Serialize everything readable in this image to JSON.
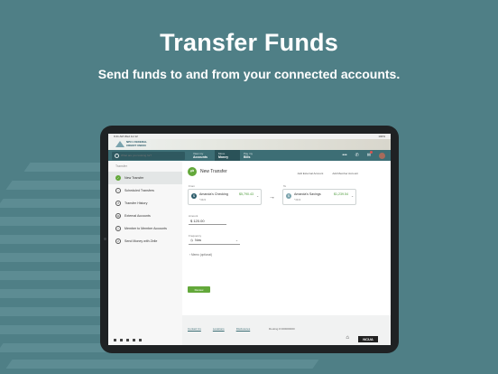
{
  "hero": {
    "title": "Transfer Funds",
    "subtitle": "Send funds to and from your connected accounts."
  },
  "statusbar": {
    "time": "9:41 AM   Wed Jul 12",
    "battery": "100%"
  },
  "brand": {
    "line1": "NPC1 FEDERAL",
    "line2": "CREDIT UNION"
  },
  "search": {
    "placeholder": "What are you looking for?"
  },
  "nav": {
    "tabs": [
      {
        "top": "View my",
        "bottom": "Accounts"
      },
      {
        "top": "Move",
        "bottom": "Money"
      },
      {
        "top": "Pay my",
        "bottom": "Bills"
      }
    ],
    "active_tab": 1
  },
  "sidebar": {
    "heading": "Transfer",
    "items": [
      {
        "label": "New Transfer",
        "active": true
      },
      {
        "label": "Scheduled Transfers"
      },
      {
        "label": "Transfer History"
      },
      {
        "label": "External Accounts"
      },
      {
        "label": "Member to Member Accounts"
      },
      {
        "label": "Send Money with Zelle"
      }
    ]
  },
  "transfer": {
    "title": "New Transfer",
    "add_external": "Add External Account",
    "add_member": "Add Member Account",
    "from_label": "From",
    "to_label": "To",
    "from": {
      "name": "Amanda's Checking",
      "sub": "*4321",
      "balance": "$5,790.43"
    },
    "to": {
      "name": "Amanda's Savings",
      "sub": "*4322",
      "balance": "$1,239.54"
    },
    "amount_label": "Amount",
    "amount": "$ 120.00",
    "frequency_label": "Frequency",
    "frequency": "Now",
    "memo": "Memo (optional)",
    "review_button": "Review"
  },
  "footer": {
    "links": [
      "Contact Us",
      "Locations",
      "Disclosures"
    ],
    "routing": "Routing # 000000000",
    "ncua": "NCUA"
  },
  "colors": {
    "accent": "#63a83a",
    "nav": "#3d6e75",
    "background": "#4f7f86"
  }
}
